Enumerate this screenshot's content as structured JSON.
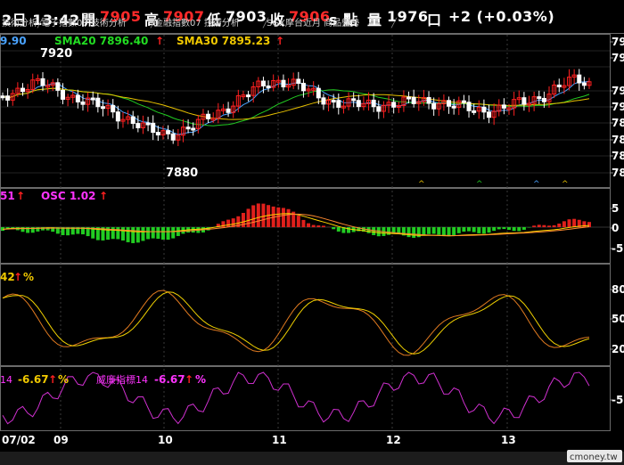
{
  "header": {
    "date_time": "2日 13:42",
    "open_label": "開",
    "open_value": "7905",
    "high_label": "高",
    "high_value": "7907",
    "low_label": "低",
    "low_value": "7903",
    "close_label": "收",
    "close_value": "7906",
    "points_unit": "s 點",
    "volume_label": "量",
    "volume_value": "1976",
    "volume_unit": "口",
    "change": "+2 (+0.03%)"
  },
  "tabs": [
    "技術分析",
    "電子指數07 技術分析",
    "金融指數07 技術分析",
    "SGX摩台近月 商品盤勢"
  ],
  "price_panel": {
    "left_partial": "9.90",
    "sma20_label": "SMA20 7896.40",
    "sma30_label": "SMA30 7895.23",
    "high_marker": "7920",
    "low_marker": "7880",
    "right_ticks": [
      "79",
      "79",
      "79",
      "79",
      "78",
      "78",
      "78",
      "78"
    ]
  },
  "macd_panel": {
    "left_partial": "51",
    "osc_label": "OSC 1.02",
    "right_ticks": [
      "5",
      "0",
      "-5"
    ]
  },
  "kd_panel": {
    "left_partial": "42",
    "pct": "%",
    "right_ticks": [
      "80",
      "50",
      "20"
    ]
  },
  "wr_panel": {
    "left_partial": "14",
    "left_value": "-6.67",
    "pct": "%",
    "name": "威廉指標14",
    "value": "-6.67",
    "right_ticks": [
      "-5"
    ]
  },
  "x_axis": {
    "labels": [
      "07/02",
      "09",
      "10",
      "11",
      "12",
      "13"
    ]
  },
  "watermark": "cmoney.tw",
  "colors": {
    "up": "#ff2020",
    "down": "#ffffff",
    "macd_up": "#e0201c",
    "macd_down": "#22cc22",
    "ma_fast": "#4aa3ff",
    "ma_mid": "#22cc22",
    "ma_slow": "#e6c000",
    "osc": "#ff33ff",
    "grid": "#3a3a3a"
  }
}
